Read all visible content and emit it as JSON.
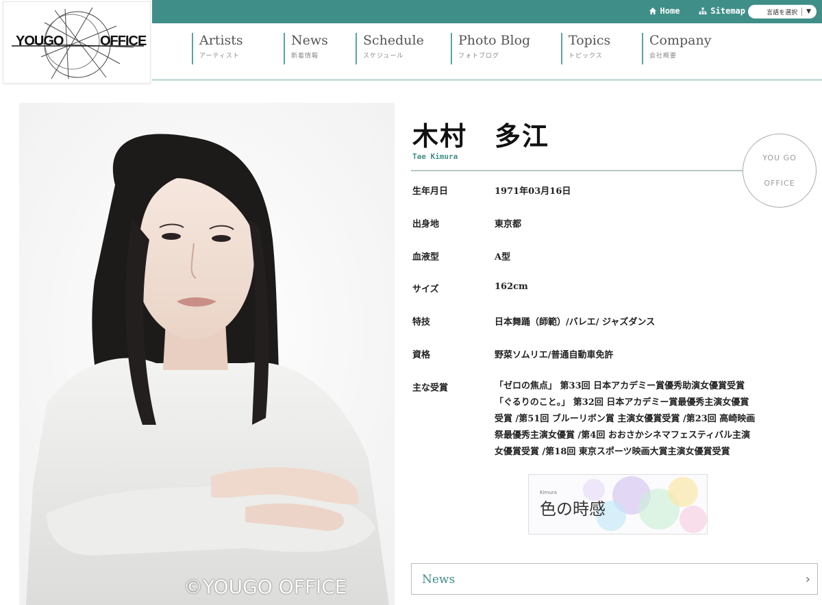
{
  "header": {
    "logo": {
      "left": "YOUGO",
      "right": "OFFICE"
    },
    "top_links": [
      {
        "label": "Home",
        "icon": "home-icon"
      },
      {
        "label": "Sitemap",
        "icon": "sitemap-icon"
      }
    ],
    "language_select": {
      "value": "言語を選択",
      "icon": "chevron-down-icon"
    }
  },
  "nav": [
    {
      "en": "Artists",
      "ja": "アーティスト"
    },
    {
      "en": "News",
      "ja": "新着情報"
    },
    {
      "en": "Schedule",
      "ja": "スケジュール"
    },
    {
      "en": "Photo Blog",
      "ja": "フォトブログ"
    },
    {
      "en": "Topics",
      "ja": "トピックス"
    },
    {
      "en": "Company",
      "ja": "会社概要"
    }
  ],
  "photo": {
    "copyright": "©YOUGO OFFICE"
  },
  "profile": {
    "name": "木村　多江",
    "name_en": "Tae Kimura",
    "badge": {
      "line1": "YOU GO",
      "line2": "OFFICE"
    },
    "rows": [
      {
        "label": "生年月日",
        "value": "1971年03月16日"
      },
      {
        "label": "出身地",
        "value": "東京都"
      },
      {
        "label": "血液型",
        "value": "A型"
      },
      {
        "label": "サイズ",
        "value": "162cm"
      },
      {
        "label": "特技",
        "value": "日本舞踊（師範）/バレエ/ ジャズダンス"
      },
      {
        "label": "資格",
        "value": "野菜ソムリエ/普通自動車免許"
      }
    ],
    "awards": {
      "label": "主な受賞",
      "lines": [
        "「ゼロの焦点」 第33回 日本アカデミー賞優秀助演女優賞受賞",
        "「ぐるりのこと。」 第32回 日本アカデミー賞最優秀主演女優賞",
        "受賞 /第51回 ブルーリボン賞 主演女優賞受賞 /第23回 高崎映画",
        "祭最優秀主演女優賞 /第4回 おおさかシネマフェスティバル主演",
        "女優賞受賞 /第18回 東京スポーツ映画大賞主演女優賞受賞"
      ]
    }
  },
  "banner": {
    "small": "Kimura",
    "title": "色の時感"
  },
  "news_box": {
    "label": "News",
    "icon": "chevron-right-icon"
  },
  "colors": {
    "accent": "#3f8f88",
    "rule": "#c9dfdc"
  }
}
